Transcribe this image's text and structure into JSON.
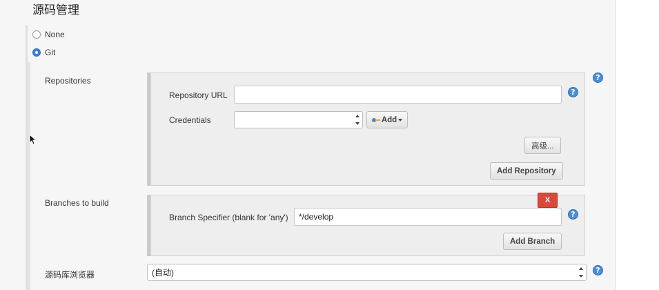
{
  "section": {
    "title": "源码管理"
  },
  "scm_options": [
    {
      "label": "None",
      "selected": false
    },
    {
      "label": "Git",
      "selected": true
    }
  ],
  "repositories": {
    "label": "Repositories",
    "url_label": "Repository URL",
    "url_value": "",
    "credentials_label": "Credentials",
    "credentials_value": "",
    "add_label": "Add",
    "advanced_label": "高级...",
    "add_repository_label": "Add Repository"
  },
  "branches": {
    "label": "Branches to build",
    "delete_label": "X",
    "specifier_label": "Branch Specifier (blank for 'any')",
    "specifier_value": "*/develop",
    "add_branch_label": "Add Branch"
  },
  "browser": {
    "label": "源码库浏览器",
    "selected": "(自动)"
  },
  "help_glyph": "?",
  "colors": {
    "accent_blue": "#4b8ed8",
    "delete_red": "#d9483b",
    "panel_bg": "#f6f6f6",
    "box_bg": "#eeeeee"
  }
}
